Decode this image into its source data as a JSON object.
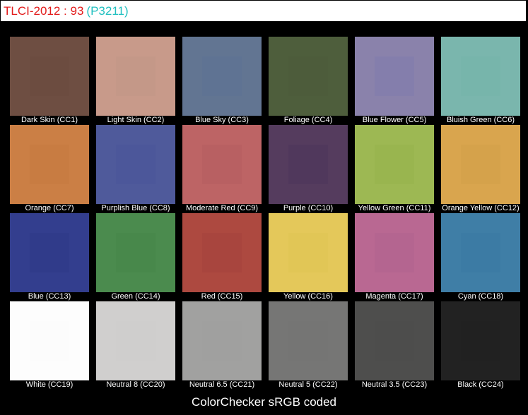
{
  "header": {
    "title": "TLCI-2012 : 93",
    "subtitle": "(P3211)"
  },
  "patches": [
    {
      "label": "Dark Skin (CC1)",
      "outer": "#6e4e42",
      "inner": "#6c4c40"
    },
    {
      "label": "Light Skin (CC2)",
      "outer": "#c89a8a",
      "inner": "#c49888"
    },
    {
      "label": "Blue Sky (CC3)",
      "outer": "#627592",
      "inner": "#5f7393"
    },
    {
      "label": "Foliage (CC4)",
      "outer": "#4e5e3c",
      "inner": "#4d5c3b"
    },
    {
      "label": "Blue Flower (CC5)",
      "outer": "#8a82ab",
      "inner": "#847eac"
    },
    {
      "label": "Bluish Green (CC6)",
      "outer": "#7ab6ad",
      "inner": "#77b5ab"
    },
    {
      "label": "Orange (CC7)",
      "outer": "#cb7f45",
      "inner": "#c87c42"
    },
    {
      "label": "Purplish Blue (CC8)",
      "outer": "#4f5a9b",
      "inner": "#4c579a"
    },
    {
      "label": "Moderate Red (CC9)",
      "outer": "#bd6465",
      "inner": "#b86062"
    },
    {
      "label": "Purple (CC10)",
      "outer": "#553c5e",
      "inner": "#50385c"
    },
    {
      "label": "Yellow Green (CC11)",
      "outer": "#9db853",
      "inner": "#99b54f"
    },
    {
      "label": "Orange Yellow (CC12)",
      "outer": "#d9a54e",
      "inner": "#d5a24b"
    },
    {
      "label": "Blue (CC13)",
      "outer": "#333e8e",
      "inner": "#303b8a"
    },
    {
      "label": "Green (CC14)",
      "outer": "#4b8b4e",
      "inner": "#48884b"
    },
    {
      "label": "Red (CC15)",
      "outer": "#ad4940",
      "inner": "#a8453e"
    },
    {
      "label": "Yellow (CC16)",
      "outer": "#e4c85a",
      "inner": "#e1c656"
    },
    {
      "label": "Magenta (CC17)",
      "outer": "#b96892",
      "inner": "#b46590"
    },
    {
      "label": "Cyan (CC18)",
      "outer": "#3f7ea6",
      "inner": "#3c7ba4"
    },
    {
      "label": "White (CC19)",
      "outer": "#fdfdfd",
      "inner": "#fcfcfc"
    },
    {
      "label": "Neutral 8 (CC20)",
      "outer": "#d0cfce",
      "inner": "#cfcecd"
    },
    {
      "label": "Neutral 6.5 (CC21)",
      "outer": "#a1a1a0",
      "inner": "#a0a09f"
    },
    {
      "label": "Neutral 5 (CC22)",
      "outer": "#767675",
      "inner": "#757574"
    },
    {
      "label": "Neutral 3.5 (CC23)",
      "outer": "#4e4e4d",
      "inner": "#4d4d4c"
    },
    {
      "label": "Black (CC24)",
      "outer": "#222222",
      "inner": "#212121"
    }
  ],
  "footer": {
    "caption": "ColorChecker sRGB coded"
  }
}
